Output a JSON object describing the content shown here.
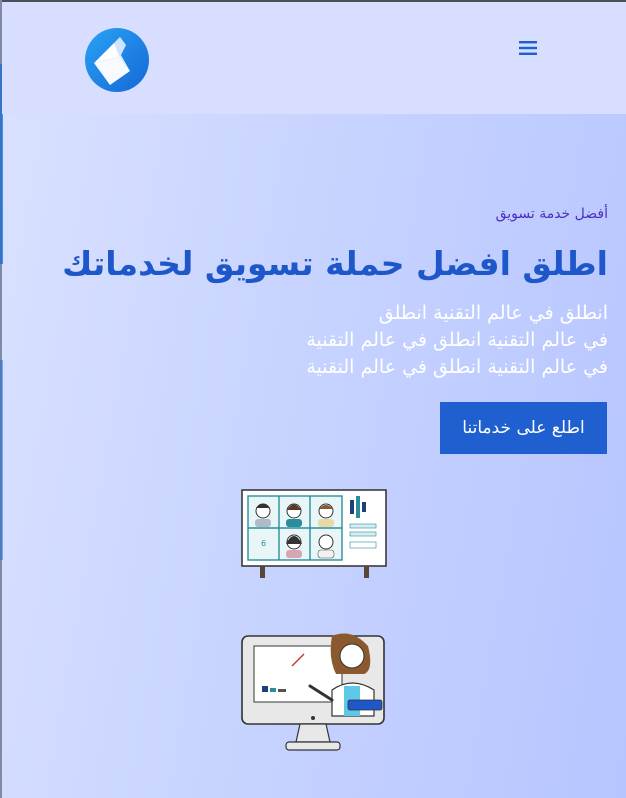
{
  "header": {
    "logo_icon": "origami-bird-logo-icon",
    "menu_icon": "hamburger-menu-icon"
  },
  "hero": {
    "eyebrow": "أفضل خدمة تسويق",
    "headline": "اطلق افضل حملة تسويق لخدماتك",
    "description_lines": [
      "انطلق في عالم التقنية انطلق",
      "في عالم التقنية انطلق في عالم التقنية",
      "في عالم التقنية انطلق في عالم التقنية"
    ],
    "cta_label": "اطلع على خدماتنا",
    "illustration_1": "video-conference-board-illustration",
    "illustration_2": "online-teacher-monitor-illustration"
  },
  "colors": {
    "accent": "#1f5fd0",
    "headline": "#1d57c9",
    "eyebrow": "#4a2fc4",
    "header_bg": "#d7deff"
  }
}
